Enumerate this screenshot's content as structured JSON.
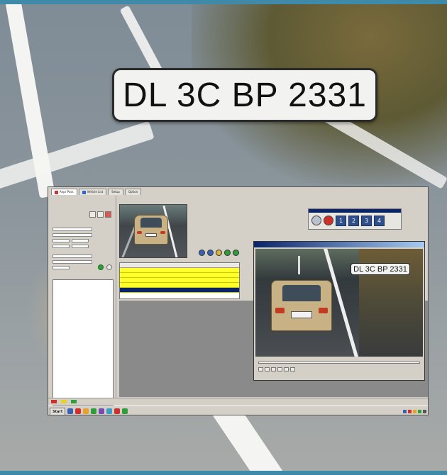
{
  "plate_text": "DL 3C BP 2331",
  "viewer_plate_text": "DL 3C BP 2331",
  "app": {
    "tabs": [
      {
        "label": "Anpr Pass",
        "active": true
      },
      {
        "label": "Vehicle List",
        "active": false
      },
      {
        "label": "Setup",
        "active": false
      },
      {
        "label": "Option",
        "active": false
      }
    ],
    "control_buttons": [
      "1",
      "2",
      "3",
      "4"
    ],
    "start_label": "Start"
  },
  "colors": {
    "frame": "#3f8aa8",
    "grid_highlight": "#ffff2a",
    "selection": "#0a246a",
    "button_blue": "#2f4f8a"
  }
}
